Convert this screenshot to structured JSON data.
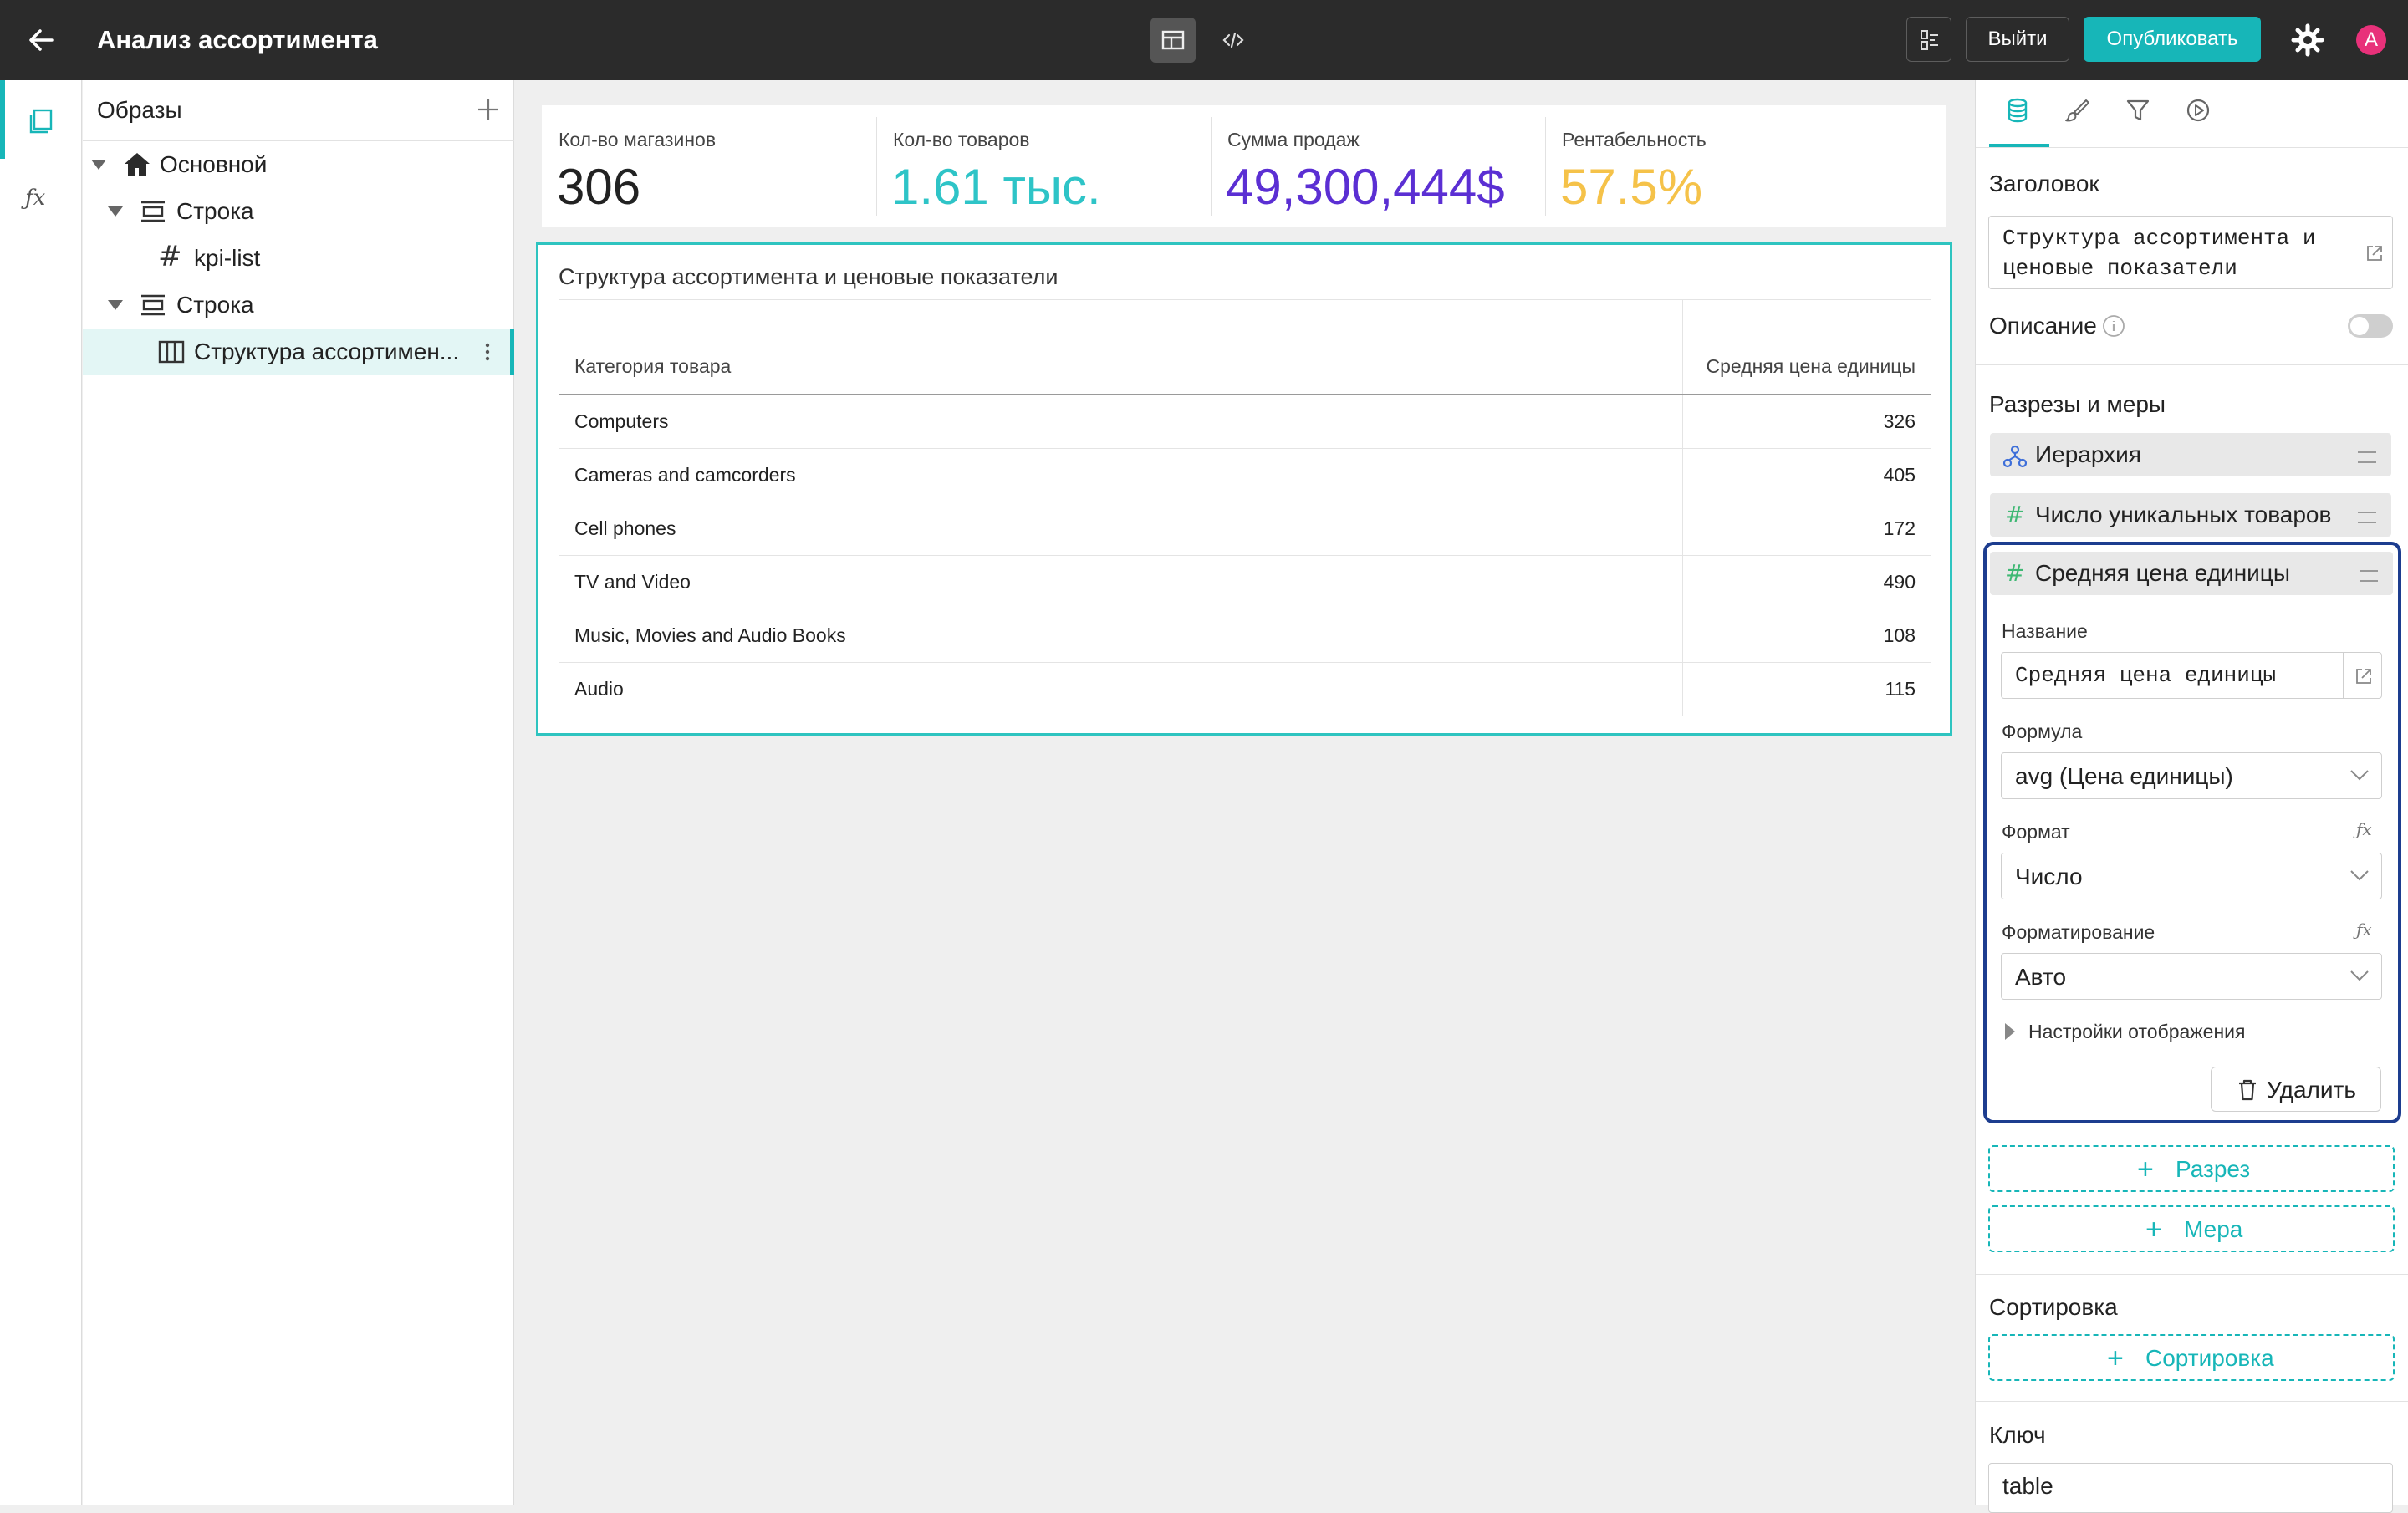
{
  "header": {
    "title": "Анализ ассортимента",
    "exit_label": "Выйти",
    "publish_label": "Опубликовать",
    "avatar_letter": "A",
    "accent_color": "#17b6b8"
  },
  "tree": {
    "title": "Образы",
    "nodes": [
      {
        "label": "Основной",
        "icon": "home-icon"
      },
      {
        "label": "Строка",
        "icon": "row-icon"
      },
      {
        "label": "kpi-list",
        "icon": "hash-icon"
      },
      {
        "label": "Строка",
        "icon": "row-icon"
      },
      {
        "label": "Структура ассортимен...",
        "icon": "table-icon",
        "selected": true
      }
    ]
  },
  "kpis": [
    {
      "label": "Кол-во магазинов",
      "value": "306",
      "color": "#222222"
    },
    {
      "label": "Кол-во товаров",
      "value": "1.61 тыс.",
      "color": "#2ec4c7"
    },
    {
      "label": "Сумма продаж",
      "value": "49,300,444$",
      "color": "#5b2fd3"
    },
    {
      "label": "Рентабельность",
      "value": "57.5%",
      "color": "#f5c249"
    }
  ],
  "table": {
    "title": "Структура ассортимента и ценовые показатели",
    "columns": [
      "Категория товара",
      "Средняя цена единицы"
    ],
    "rows": [
      [
        "Computers",
        "326"
      ],
      [
        "Cameras and camcorders",
        "405"
      ],
      [
        "Cell phones",
        "172"
      ],
      [
        "TV and Video",
        "490"
      ],
      [
        "Music, Movies and Audio Books",
        "108"
      ],
      [
        "Audio",
        "115"
      ]
    ]
  },
  "props": {
    "title_label": "Заголовок",
    "title_value": "Структура ассортимента и ценовые показатели",
    "description_label": "Описание",
    "cuts_label": "Разрезы и меры",
    "items": [
      "Иерархия",
      "Число уникальных товаров",
      "Средняя цена единицы"
    ],
    "measure": {
      "name_label": "Название",
      "name_value": "Средняя цена единицы",
      "formula_label": "Формула",
      "formula_value": "avg (Цена единицы)",
      "format_label": "Формат",
      "format_value": "Число",
      "formatting_label": "Форматирование",
      "formatting_value": "Авто",
      "display_label": "Настройки отображения",
      "delete_label": "Удалить"
    },
    "add_cut": "Разрез",
    "add_measure": "Мера",
    "sort_label": "Сортировка",
    "add_sort": "Сортировка",
    "key_label": "Ключ",
    "key_value": "table"
  }
}
